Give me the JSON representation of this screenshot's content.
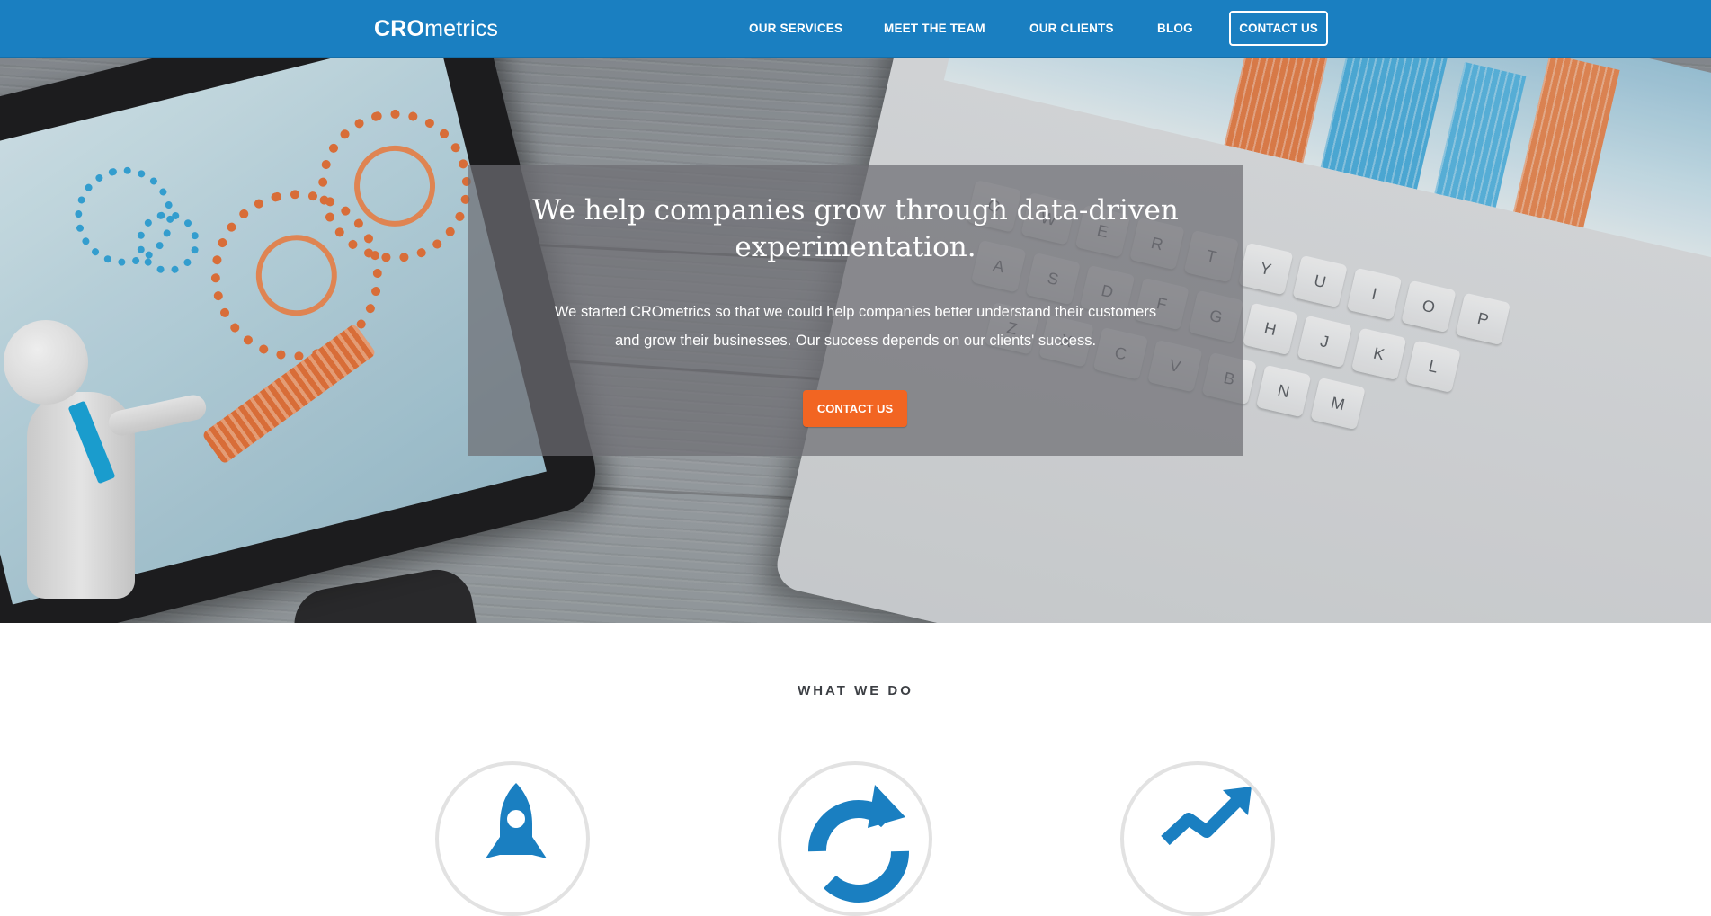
{
  "brand": {
    "logo_bold": "CRO",
    "logo_light": "metrics",
    "primary_color": "#1a7fc1",
    "accent_color": "#f26522"
  },
  "nav": {
    "items": [
      {
        "label": "OUR SERVICES"
      },
      {
        "label": "MEET THE TEAM"
      },
      {
        "label": "OUR CLIENTS"
      },
      {
        "label": "BLOG"
      }
    ],
    "contact_label": "CONTACT US"
  },
  "hero": {
    "title_line1": "We help companies grow through data-driven",
    "title_line2": "experimentation.",
    "text_line1": "We started CROmetrics so that we could help companies better understand their customers",
    "text_line2": "and grow their businesses. Our success depends on our clients' success.",
    "button_label": "CONTACT US"
  },
  "what_we_do": {
    "title": "WHAT WE DO",
    "icons": [
      {
        "icon": "rocket-icon"
      },
      {
        "icon": "refresh-icon"
      },
      {
        "icon": "growth-arrow-icon"
      }
    ]
  }
}
